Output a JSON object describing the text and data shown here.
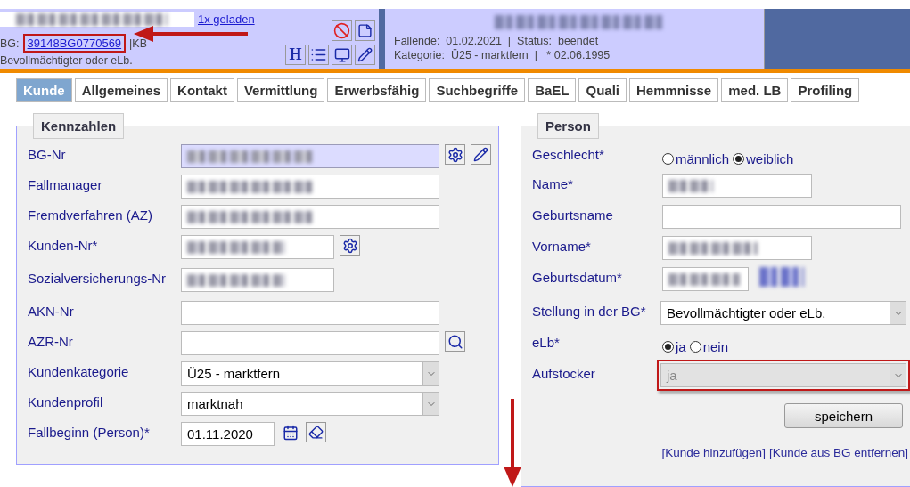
{
  "header": {
    "loaded_link": "1x geladen",
    "bg_label": "BG:",
    "bg_link": "39148BG0770569",
    "bg_link_annotated": true,
    "kb_text": "|KB",
    "role": "Bevollmächtigter oder eLb.",
    "h_key": "H",
    "case_line": "Fallende:  01.02.2021  |  Status:  beendet",
    "category_line": "Kategorie:  Ü25 - marktfern  |   * 02.06.1995"
  },
  "tabs": [
    {
      "label": "Kunde",
      "selected": true
    },
    {
      "label": "Allgemeines",
      "selected": false
    },
    {
      "label": "Kontakt",
      "selected": false
    },
    {
      "label": "Vermittlung",
      "selected": false
    },
    {
      "label": "Erwerbsfähig",
      "selected": false
    },
    {
      "label": "Suchbegriffe",
      "selected": false
    },
    {
      "label": "BaEL",
      "selected": false
    },
    {
      "label": "Quali",
      "selected": false
    },
    {
      "label": "Hemmnisse",
      "selected": false
    },
    {
      "label": "med. LB",
      "selected": false
    },
    {
      "label": "Profiling",
      "selected": false
    }
  ],
  "kennzahlen": {
    "title": "Kennzahlen",
    "rows": [
      {
        "label": "BG-Nr",
        "kind": "redacted",
        "highlighted": true,
        "tools": [
          {
            "kind": "gear"
          },
          {
            "kind": "pencil"
          }
        ]
      },
      {
        "label": "Fallmanager",
        "kind": "redacted",
        "highlighted": false
      },
      {
        "label": "Fremdverfahren (AZ)",
        "kind": "redacted",
        "highlighted": false
      },
      {
        "label": "Kunden-Nr*",
        "kind": "redacted",
        "highlighted": false,
        "tools": [
          {
            "kind": "gear"
          }
        ]
      },
      {
        "label": "Sozialversicherungs-Nr",
        "kind": "redacted",
        "highlighted": false
      },
      {
        "label": "AKN-Nr",
        "kind": "text"
      },
      {
        "label": "AZR-Nr",
        "kind": "text",
        "tools": [
          {
            "kind": "search"
          }
        ]
      },
      {
        "label": "Kundenkategorie",
        "kind": "select",
        "value": "Ü25 - marktfern"
      },
      {
        "label": "Kundenprofil",
        "kind": "select",
        "value": "marktnah"
      },
      {
        "label": "Fallbeginn (Person)*",
        "kind": "date",
        "value": "01.11.2020",
        "tools": [
          {
            "kind": "calendar"
          },
          {
            "kind": "eraser"
          }
        ]
      }
    ]
  },
  "person": {
    "title": "Person",
    "rows": [
      {
        "label": "Geschlecht*",
        "kind": "radio",
        "options": [
          {
            "label": "männlich",
            "selected": false
          },
          {
            "label": "weiblich",
            "selected": true
          }
        ]
      },
      {
        "label": "Name*",
        "kind": "redacted"
      },
      {
        "label": "Geburtsname",
        "kind": "text"
      },
      {
        "label": "Vorname*",
        "kind": "redacted"
      },
      {
        "label": "Geburtsdatum*",
        "kind": "redacted-date"
      },
      {
        "label": "Stellung in der BG*",
        "kind": "select",
        "value": "Bevollmächtigter oder eLb.",
        "disabled": false,
        "annotated": false
      },
      {
        "label": "eLb*",
        "kind": "radio",
        "options": [
          {
            "label": "ja",
            "selected": true
          },
          {
            "label": "nein",
            "selected": false
          }
        ]
      },
      {
        "label": "Aufstocker",
        "kind": "select",
        "value": "ja",
        "disabled": true,
        "annotated": true
      }
    ],
    "save_button": "speichern",
    "links": [
      "[Kunde hinzufügen]",
      "[Kunde aus BG entfernen]"
    ]
  }
}
